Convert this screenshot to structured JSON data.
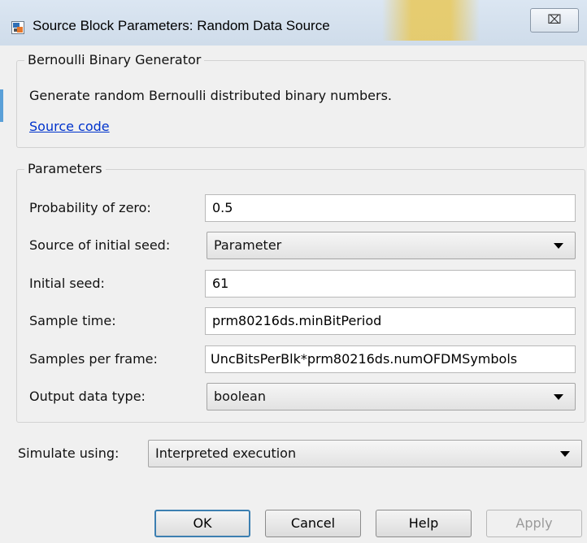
{
  "window": {
    "title": "Source Block Parameters: Random Data Source",
    "close_symbol": "⌧"
  },
  "description": {
    "group_title": "Bernoulli Binary Generator",
    "text": "Generate random Bernoulli distributed binary numbers.",
    "link": "Source code"
  },
  "parameters": {
    "group_title": "Parameters",
    "probability_of_zero": {
      "label": "Probability of zero:",
      "value": "0.5"
    },
    "source_of_initial_seed": {
      "label": "Source of initial seed:",
      "value": "Parameter"
    },
    "initial_seed": {
      "label": "Initial seed:",
      "value": "61"
    },
    "sample_time": {
      "label": "Sample time:",
      "value": "prm80216ds.minBitPeriod"
    },
    "samples_per_frame": {
      "label": "Samples per frame:",
      "value": "UncBitsPerBlk*prm80216ds.numOFDMSymbols"
    },
    "output_data_type": {
      "label": "Output data type:",
      "value": "boolean"
    }
  },
  "simulate": {
    "label": "Simulate using:",
    "value": "Interpreted execution"
  },
  "buttons": {
    "ok": "OK",
    "cancel": "Cancel",
    "help": "Help",
    "apply": "Apply"
  }
}
